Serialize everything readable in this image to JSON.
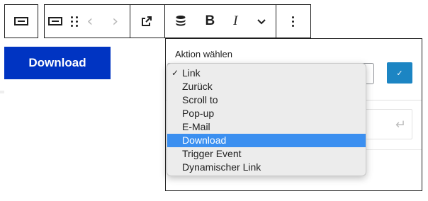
{
  "toolbar": {
    "block_type_icon": "button-block-icon",
    "block_icon": "button-block-icon",
    "drag_icon": "drag-handle-icon",
    "mover_glyphs": "‹ ›",
    "link_icon": "external-link-icon",
    "database_icon": "database-icon",
    "bold_label": "B",
    "italic_label": "I",
    "more_icon": "chevron-down-icon",
    "options_icon": "more-vertical-icon"
  },
  "button_block": {
    "label": "Download",
    "background": "#0034c2"
  },
  "popover": {
    "label": "Aktion wählen",
    "apply_icon": "checkmark-icon",
    "apply_color": "#1c85c3",
    "enter_icon": "enter-return-icon"
  },
  "dropdown": {
    "checked_mark": "✓",
    "selected_color": "#3b8ff0",
    "options": [
      {
        "label": "Link",
        "checked": true,
        "highlighted": false
      },
      {
        "label": "Zurück",
        "checked": false,
        "highlighted": false
      },
      {
        "label": "Scroll to",
        "checked": false,
        "highlighted": false
      },
      {
        "label": "Pop-up",
        "checked": false,
        "highlighted": false
      },
      {
        "label": "E-Mail",
        "checked": false,
        "highlighted": false
      },
      {
        "label": "Download",
        "checked": false,
        "highlighted": true
      },
      {
        "label": "Trigger Event",
        "checked": false,
        "highlighted": false
      },
      {
        "label": "Dynamischer Link",
        "checked": false,
        "highlighted": false
      }
    ]
  }
}
